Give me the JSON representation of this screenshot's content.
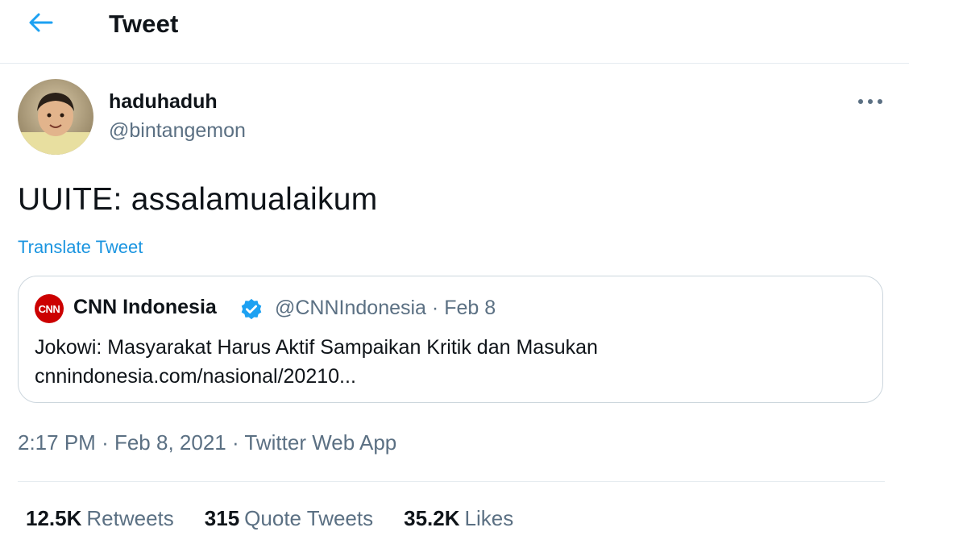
{
  "header": {
    "back_icon": "arrow-left-icon",
    "title": "Tweet",
    "accent_color": "#1da1f2"
  },
  "tweet": {
    "author_name": "haduhaduh",
    "author_handle": "@bintangemon",
    "avatar_icon": "user-avatar",
    "more_icon": "more-horizontal-icon",
    "text": "UUITE: assalamualaikum",
    "translate_label": "Translate Tweet",
    "translate_color": "#1b95e0",
    "time": "2:17 PM",
    "date": "Feb 8, 2021",
    "source": "Twitter Web App",
    "separator": "·"
  },
  "quoted": {
    "logo_text": "CNN",
    "logo_color": "#cc0000",
    "name": "CNN Indonesia",
    "verified_icon": "verified-badge-icon",
    "handle": "@CNNIndonesia",
    "date": "Feb 8",
    "text_line1": "Jokowi: Masyarakat Harus Aktif Sampaikan Kritik dan Masukan",
    "text_line2": "cnnindonesia.com/nasional/20210..."
  },
  "stats": {
    "retweets_count": "12.5K",
    "retweets_label": "Retweets",
    "quotes_count": "315",
    "quotes_label": "Quote Tweets",
    "likes_count": "35.2K",
    "likes_label": "Likes"
  }
}
